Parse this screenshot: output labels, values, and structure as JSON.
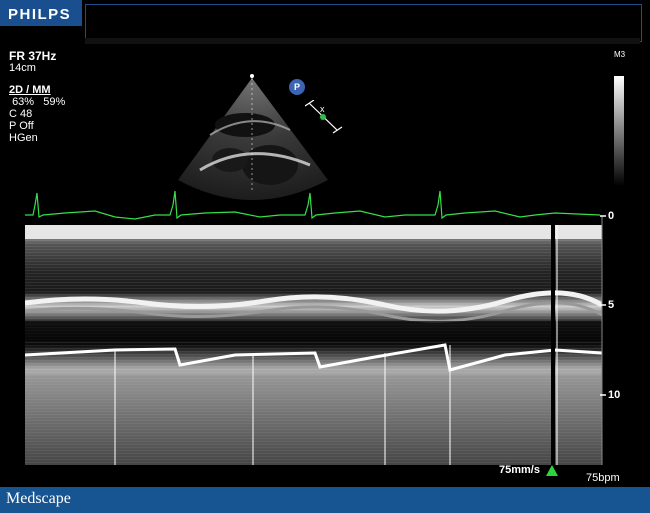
{
  "header": {
    "brand": "PHILPS"
  },
  "params": {
    "frame_rate": "FR 37Hz",
    "depth": "14cm",
    "mode": "2D / MM",
    "gain_2d": "63%",
    "gain_mm": "59%",
    "compression": "C 48",
    "persistence": "P Off",
    "harmonic": "HGen"
  },
  "probe_badge": "P",
  "grayscale_label": "M3",
  "depth_scale": {
    "labels": [
      "0",
      "5",
      "10"
    ]
  },
  "sweep_speed": "75mm/s",
  "heart_rate": "75bpm",
  "footer": {
    "logo": "Medscape"
  },
  "colors": {
    "ecg": "#35e04a",
    "footer": "#165592",
    "header_box": "#1a4f8f",
    "marker": "#2dd63a"
  }
}
